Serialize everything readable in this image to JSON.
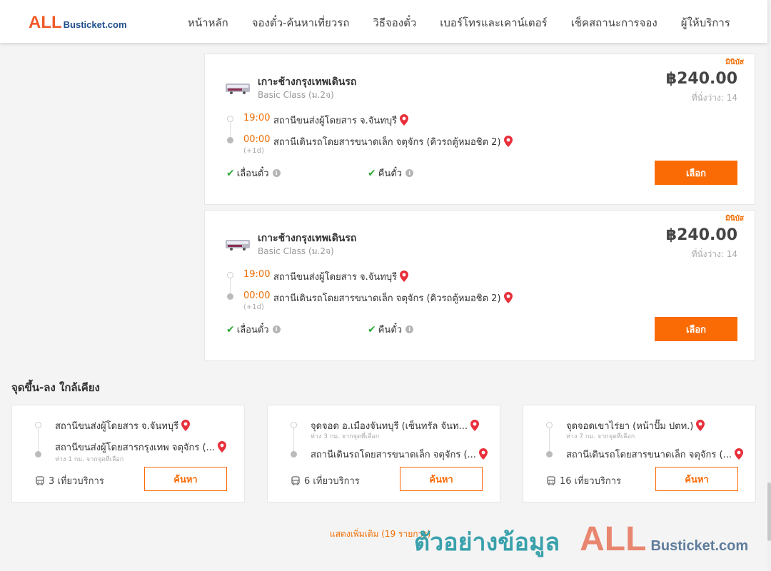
{
  "header": {
    "logo_all": "ALL",
    "logo_rest": "Busticket.com",
    "nav": [
      "หน้าหลัก",
      "จองตั๋ว-ค้นหาเที่ยวรถ",
      "วิธีจองตั๋ว",
      "เบอร์โทรและเคาน์เตอร์",
      "เช็คสถานะการจอง",
      "ผู้ให้บริการ"
    ]
  },
  "trips": [
    {
      "tag": "มินิบัส",
      "route": "เกาะช้างกรุงเทพเดินรถ",
      "bus_class": "Basic Class (ม.2จ)",
      "price": "฿240.00",
      "seats": "ที่นั่งว่าง: 14",
      "dep_time": "19:00",
      "dep_place": "สถานีขนส่งผู้โดยสาร จ.จันทบุรี",
      "arr_time": "00:00",
      "arr_place": "สถานีเดินรถโดยสารขนาดเล็ก จตุจักร (คิวรถตู้หมอชิต 2)",
      "next_day": "(+1d)",
      "feature1": "เลื่อนตั๋ว",
      "feature2": "คืนตั๋ว",
      "button": "เลือก"
    },
    {
      "tag": "มินิบัส",
      "route": "เกาะช้างกรุงเทพเดินรถ",
      "bus_class": "Basic Class (ม.2จ)",
      "price": "฿240.00",
      "seats": "ที่นั่งว่าง: 14",
      "dep_time": "19:00",
      "dep_place": "สถานีขนส่งผู้โดยสาร จ.จันทบุรี",
      "arr_time": "00:00",
      "arr_place": "สถานีเดินรถโดยสารขนาดเล็ก จตุจักร (คิวรถตู้หมอชิต 2)",
      "next_day": "(+1d)",
      "feature1": "เลื่อนตั๋ว",
      "feature2": "คืนตั๋ว",
      "button": "เลือก"
    }
  ],
  "nearby": {
    "title": "จุดขึ้น-ลง ใกล้เคียง",
    "cards": [
      {
        "from": "สถานีขนส่งผู้โดยสาร จ.จันทบุรี",
        "from_distance": "",
        "to": "สถานีขนส่งผู้โดยสารกรุงเทพ จตุจักร (...",
        "to_distance": "ห่าง 1 กม. จากจุดที่เลือก",
        "trips": "3 เที่ยวบริการ",
        "button": "ค้นหา"
      },
      {
        "from": "จุดจอด อ.เมืองจันทบุรี (เซ็นทรัล จันท...",
        "from_distance": "ห่าง 3 กม. จากจุดที่เลือก",
        "to": "สถานีเดินรถโดยสารขนาดเล็ก จตุจักร (...",
        "to_distance": "",
        "trips": "6 เที่ยวบริการ",
        "button": "ค้นหา"
      },
      {
        "from": "จุดจอดเขาไร่ยา (หน้าปั๊ม ปตท.)",
        "from_distance": "ห่าง 7 กม. จากจุดที่เลือก",
        "to": "สถานีเดินรถโดยสารขนาดเล็ก จตุจักร (...",
        "to_distance": "",
        "trips": "16 เที่ยวบริการ",
        "button": "ค้นหา"
      }
    ]
  },
  "show_more": "แสดงเพิ่มเติม (19 รายการ)",
  "watermark": {
    "thai": "ตัวอย่างข้อมูล",
    "all": "ALL",
    "rest": "Busticket.com"
  },
  "colors": {
    "accent": "#fb6b05",
    "time": "#f06d00",
    "check": "#2eaa3a",
    "logo_orange": "#f05a28",
    "logo_blue": "#1f4e8c"
  }
}
